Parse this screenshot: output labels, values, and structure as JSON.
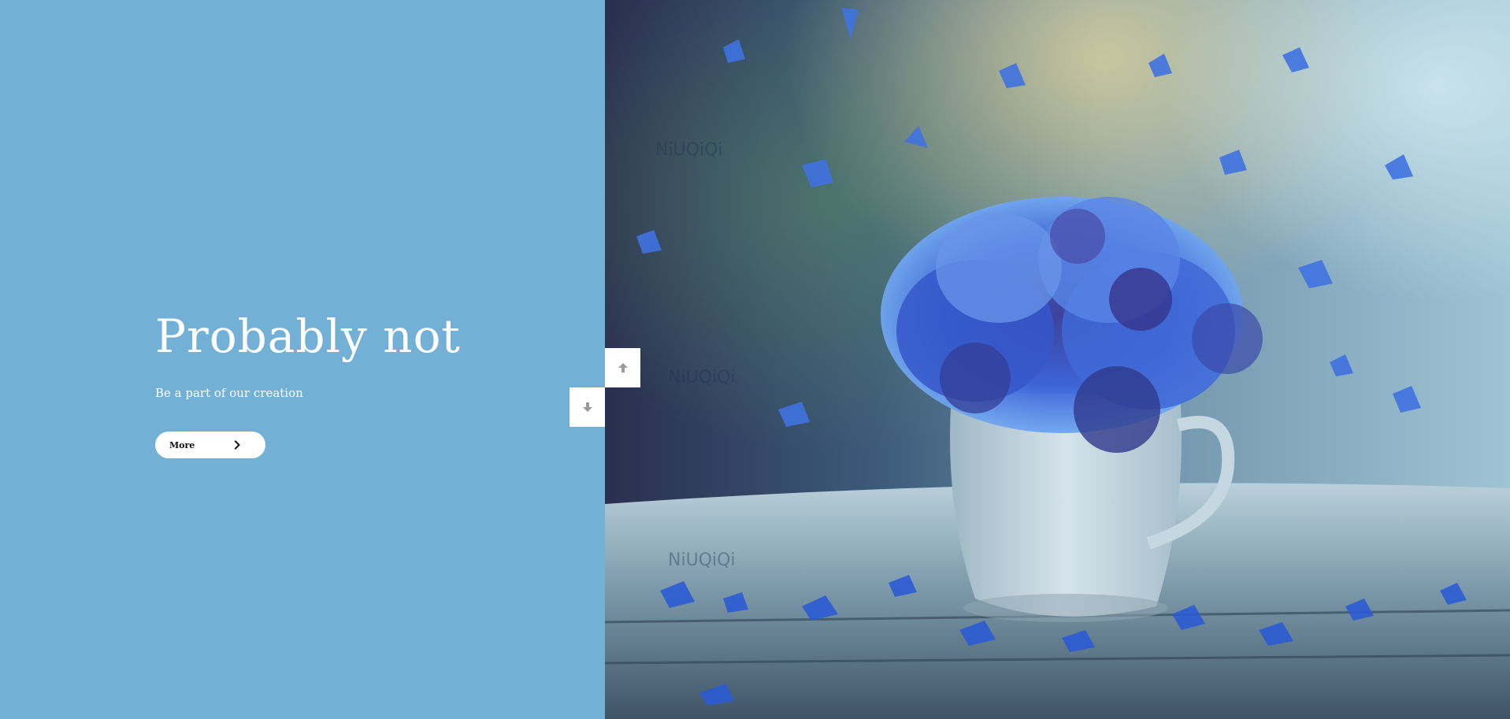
{
  "hero": {
    "title": "Probably not",
    "subtitle": "Be a part of our creation",
    "button_label": "More"
  },
  "navigation": {
    "up_icon": "arrow-up-icon",
    "down_icon": "arrow-down-icon"
  },
  "image": {
    "watermark_text": "NiUQiQi",
    "subject": "blue cornflowers in white cup"
  },
  "colors": {
    "panel_bg": "#72b0d6",
    "text": "#ffffff",
    "button_bg": "#ffffff",
    "arrow_icon": "#9a9a9a"
  }
}
